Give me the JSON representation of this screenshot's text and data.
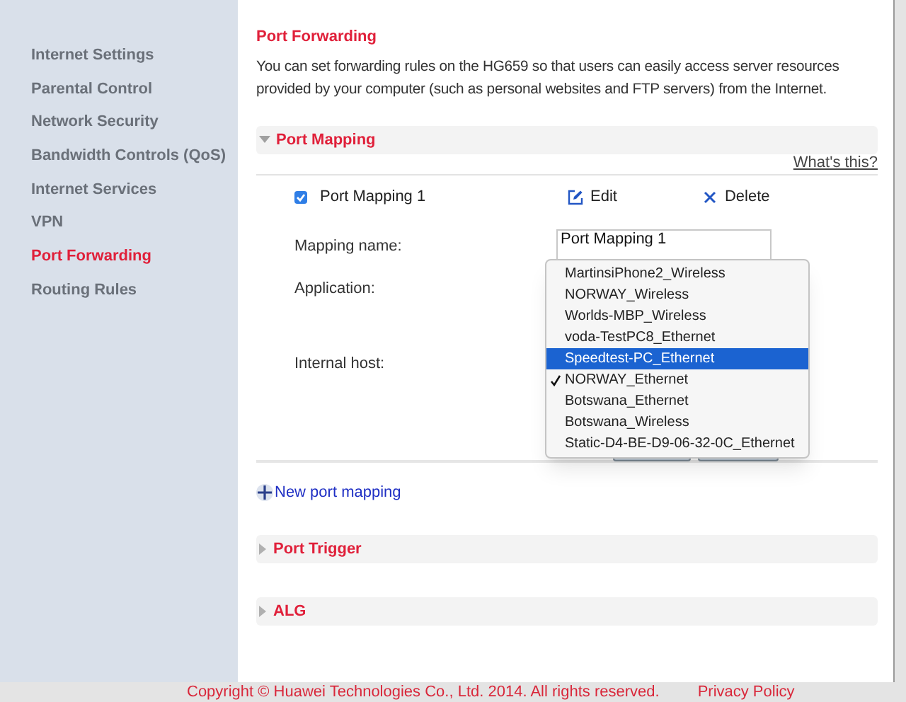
{
  "sidebar": {
    "items": [
      {
        "label": "Internet Settings",
        "selected": false
      },
      {
        "label": "Parental Control",
        "selected": false
      },
      {
        "label": "Network Security",
        "selected": false
      },
      {
        "label": "Bandwidth Controls (QoS)",
        "selected": false
      },
      {
        "label": "Internet Services",
        "selected": false
      },
      {
        "label": "VPN",
        "selected": false
      },
      {
        "label": "Port Forwarding",
        "selected": true
      },
      {
        "label": "Routing Rules",
        "selected": false
      }
    ]
  },
  "page": {
    "title": "Port Forwarding",
    "description": "You can set forwarding rules on the HG659 so that users can easily access server resources provided by your computer (such as personal websites and FTP servers) from the Internet."
  },
  "sections": [
    {
      "title": "Port Mapping",
      "expanded": true,
      "help_link": "What's this?",
      "mappings": [
        {
          "name": "Port Mapping 1",
          "checked": true,
          "edit_label": "Edit",
          "delete_label": "Delete"
        }
      ],
      "form": {
        "fields": [
          {
            "label": "Mapping name:",
            "value": "Port Mapping 1"
          },
          {
            "label": "Application:"
          },
          {
            "label": "Internal host:"
          }
        ]
      },
      "dropdown": {
        "options": [
          {
            "label": "MartinsiPhone2_Wireless",
            "selected": false,
            "checked": false
          },
          {
            "label": "NORWAY_Wireless",
            "selected": false,
            "checked": false
          },
          {
            "label": "Worlds-MBP_Wireless",
            "selected": false,
            "checked": false
          },
          {
            "label": "voda-TestPC8_Ethernet",
            "selected": false,
            "checked": false
          },
          {
            "label": "Speedtest-PC_Ethernet",
            "selected": true,
            "checked": false
          },
          {
            "label": "NORWAY_Ethernet",
            "selected": false,
            "checked": true
          },
          {
            "label": "Botswana_Ethernet",
            "selected": false,
            "checked": false
          },
          {
            "label": "Botswana_Wireless",
            "selected": false,
            "checked": false
          },
          {
            "label": "Static-D4-BE-D9-06-32-0C_Ethernet",
            "selected": false,
            "checked": false
          }
        ]
      },
      "new_link": "New port mapping"
    },
    {
      "title": "Port Trigger",
      "expanded": false
    },
    {
      "title": "ALG",
      "expanded": false
    }
  ],
  "footer": {
    "copyright": "Copyright © Huawei Technologies Co., Ltd. 2014. All rights reserved.",
    "privacy_link": "Privacy Policy"
  }
}
